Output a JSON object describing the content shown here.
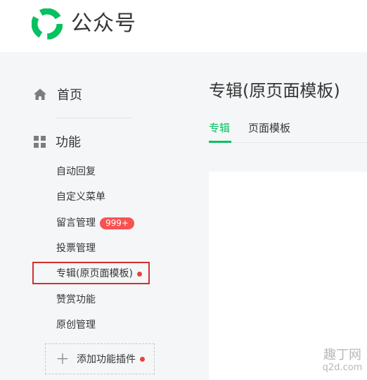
{
  "header": {
    "brand": "公众号"
  },
  "sidebar": {
    "home": {
      "label": "首页",
      "icon": "home-icon"
    },
    "function": {
      "label": "功能",
      "icon": "grid-icon"
    },
    "items": [
      {
        "label": "自动回复"
      },
      {
        "label": "自定义菜单"
      },
      {
        "label": "留言管理",
        "badge": "999+"
      },
      {
        "label": "投票管理"
      },
      {
        "label": "专辑(原页面模板)",
        "dot": true
      },
      {
        "label": "赞赏功能"
      },
      {
        "label": "原创管理"
      }
    ],
    "add_plugin": {
      "label": "添加功能插件",
      "dot": true
    }
  },
  "main": {
    "title": "专辑(原页面模板)",
    "tabs": [
      {
        "label": "专辑",
        "active": true
      },
      {
        "label": "页面模板",
        "active": false
      }
    ]
  },
  "watermark": {
    "line1": "趣丁网",
    "line2": "q2d.com"
  },
  "colors": {
    "accent": "#07c160",
    "badge": "#fa5151",
    "highlight_border": "#d32f2f"
  }
}
